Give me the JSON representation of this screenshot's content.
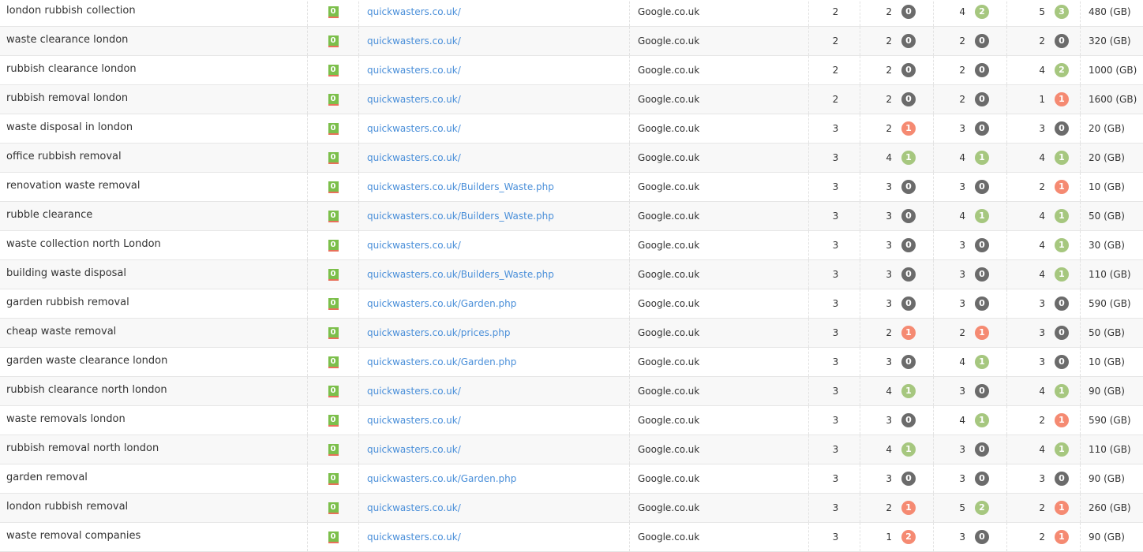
{
  "colors": {
    "k": "#6b6b6b",
    "g": "#a6c77f",
    "r": "#f58a72",
    "link": "#4a8fd9",
    "status": "#7cbf4b"
  },
  "status_icon": "index-status-badge",
  "rows": [
    {
      "keyword": "london rubbish collection",
      "status": "0",
      "url": "quickwasters.co.uk/",
      "engine": "Google.co.uk",
      "c1": "2",
      "c2": [
        "2",
        "0",
        "k"
      ],
      "c3": [
        "4",
        "2",
        "g"
      ],
      "c4": [
        "5",
        "3",
        "g"
      ],
      "size": "480 (GB)"
    },
    {
      "keyword": "waste clearance london",
      "status": "0",
      "url": "quickwasters.co.uk/",
      "engine": "Google.co.uk",
      "c1": "2",
      "c2": [
        "2",
        "0",
        "k"
      ],
      "c3": [
        "2",
        "0",
        "k"
      ],
      "c4": [
        "2",
        "0",
        "k"
      ],
      "size": "320 (GB)"
    },
    {
      "keyword": "rubbish clearance london",
      "status": "0",
      "url": "quickwasters.co.uk/",
      "engine": "Google.co.uk",
      "c1": "2",
      "c2": [
        "2",
        "0",
        "k"
      ],
      "c3": [
        "2",
        "0",
        "k"
      ],
      "c4": [
        "4",
        "2",
        "g"
      ],
      "size": "1000 (GB)"
    },
    {
      "keyword": "rubbish removal london",
      "status": "0",
      "url": "quickwasters.co.uk/",
      "engine": "Google.co.uk",
      "c1": "2",
      "c2": [
        "2",
        "0",
        "k"
      ],
      "c3": [
        "2",
        "0",
        "k"
      ],
      "c4": [
        "1",
        "1",
        "r"
      ],
      "size": "1600 (GB)"
    },
    {
      "keyword": "waste disposal in london",
      "status": "0",
      "url": "quickwasters.co.uk/",
      "engine": "Google.co.uk",
      "c1": "3",
      "c2": [
        "2",
        "1",
        "r"
      ],
      "c3": [
        "3",
        "0",
        "k"
      ],
      "c4": [
        "3",
        "0",
        "k"
      ],
      "size": "20 (GB)"
    },
    {
      "keyword": "office rubbish removal",
      "status": "0",
      "url": "quickwasters.co.uk/",
      "engine": "Google.co.uk",
      "c1": "3",
      "c2": [
        "4",
        "1",
        "g"
      ],
      "c3": [
        "4",
        "1",
        "g"
      ],
      "c4": [
        "4",
        "1",
        "g"
      ],
      "size": "20 (GB)"
    },
    {
      "keyword": "renovation waste removal",
      "status": "0",
      "url": "quickwasters.co.uk/Builders_Waste.php",
      "engine": "Google.co.uk",
      "c1": "3",
      "c2": [
        "3",
        "0",
        "k"
      ],
      "c3": [
        "3",
        "0",
        "k"
      ],
      "c4": [
        "2",
        "1",
        "r"
      ],
      "size": "10 (GB)"
    },
    {
      "keyword": "rubble clearance",
      "status": "0",
      "url": "quickwasters.co.uk/Builders_Waste.php",
      "engine": "Google.co.uk",
      "c1": "3",
      "c2": [
        "3",
        "0",
        "k"
      ],
      "c3": [
        "4",
        "1",
        "g"
      ],
      "c4": [
        "4",
        "1",
        "g"
      ],
      "size": "50 (GB)"
    },
    {
      "keyword": "waste collection north London",
      "status": "0",
      "url": "quickwasters.co.uk/",
      "engine": "Google.co.uk",
      "c1": "3",
      "c2": [
        "3",
        "0",
        "k"
      ],
      "c3": [
        "3",
        "0",
        "k"
      ],
      "c4": [
        "4",
        "1",
        "g"
      ],
      "size": "30 (GB)"
    },
    {
      "keyword": "building waste disposal",
      "status": "0",
      "url": "quickwasters.co.uk/Builders_Waste.php",
      "engine": "Google.co.uk",
      "c1": "3",
      "c2": [
        "3",
        "0",
        "k"
      ],
      "c3": [
        "3",
        "0",
        "k"
      ],
      "c4": [
        "4",
        "1",
        "g"
      ],
      "size": "110 (GB)"
    },
    {
      "keyword": "garden rubbish removal",
      "status": "0",
      "url": "quickwasters.co.uk/Garden.php",
      "engine": "Google.co.uk",
      "c1": "3",
      "c2": [
        "3",
        "0",
        "k"
      ],
      "c3": [
        "3",
        "0",
        "k"
      ],
      "c4": [
        "3",
        "0",
        "k"
      ],
      "size": "590 (GB)"
    },
    {
      "keyword": "cheap waste removal",
      "status": "0",
      "url": "quickwasters.co.uk/prices.php",
      "engine": "Google.co.uk",
      "c1": "3",
      "c2": [
        "2",
        "1",
        "r"
      ],
      "c3": [
        "2",
        "1",
        "r"
      ],
      "c4": [
        "3",
        "0",
        "k"
      ],
      "size": "50 (GB)"
    },
    {
      "keyword": "garden waste clearance london",
      "status": "0",
      "url": "quickwasters.co.uk/Garden.php",
      "engine": "Google.co.uk",
      "c1": "3",
      "c2": [
        "3",
        "0",
        "k"
      ],
      "c3": [
        "4",
        "1",
        "g"
      ],
      "c4": [
        "3",
        "0",
        "k"
      ],
      "size": "10 (GB)"
    },
    {
      "keyword": "rubbish clearance north london",
      "status": "0",
      "url": "quickwasters.co.uk/",
      "engine": "Google.co.uk",
      "c1": "3",
      "c2": [
        "4",
        "1",
        "g"
      ],
      "c3": [
        "3",
        "0",
        "k"
      ],
      "c4": [
        "4",
        "1",
        "g"
      ],
      "size": "90 (GB)"
    },
    {
      "keyword": "waste removals london",
      "status": "0",
      "url": "quickwasters.co.uk/",
      "engine": "Google.co.uk",
      "c1": "3",
      "c2": [
        "3",
        "0",
        "k"
      ],
      "c3": [
        "4",
        "1",
        "g"
      ],
      "c4": [
        "2",
        "1",
        "r"
      ],
      "size": "590 (GB)"
    },
    {
      "keyword": "rubbish removal north london",
      "status": "0",
      "url": "quickwasters.co.uk/",
      "engine": "Google.co.uk",
      "c1": "3",
      "c2": [
        "4",
        "1",
        "g"
      ],
      "c3": [
        "3",
        "0",
        "k"
      ],
      "c4": [
        "4",
        "1",
        "g"
      ],
      "size": "110 (GB)"
    },
    {
      "keyword": "garden removal",
      "status": "0",
      "url": "quickwasters.co.uk/Garden.php",
      "engine": "Google.co.uk",
      "c1": "3",
      "c2": [
        "3",
        "0",
        "k"
      ],
      "c3": [
        "3",
        "0",
        "k"
      ],
      "c4": [
        "3",
        "0",
        "k"
      ],
      "size": "90 (GB)"
    },
    {
      "keyword": "london rubbish removal",
      "status": "0",
      "url": "quickwasters.co.uk/",
      "engine": "Google.co.uk",
      "c1": "3",
      "c2": [
        "2",
        "1",
        "r"
      ],
      "c3": [
        "5",
        "2",
        "g"
      ],
      "c4": [
        "2",
        "1",
        "r"
      ],
      "size": "260 (GB)"
    },
    {
      "keyword": "waste removal companies",
      "status": "0",
      "url": "quickwasters.co.uk/",
      "engine": "Google.co.uk",
      "c1": "3",
      "c2": [
        "1",
        "2",
        "r"
      ],
      "c3": [
        "3",
        "0",
        "k"
      ],
      "c4": [
        "2",
        "1",
        "r"
      ],
      "size": "90 (GB)"
    }
  ]
}
